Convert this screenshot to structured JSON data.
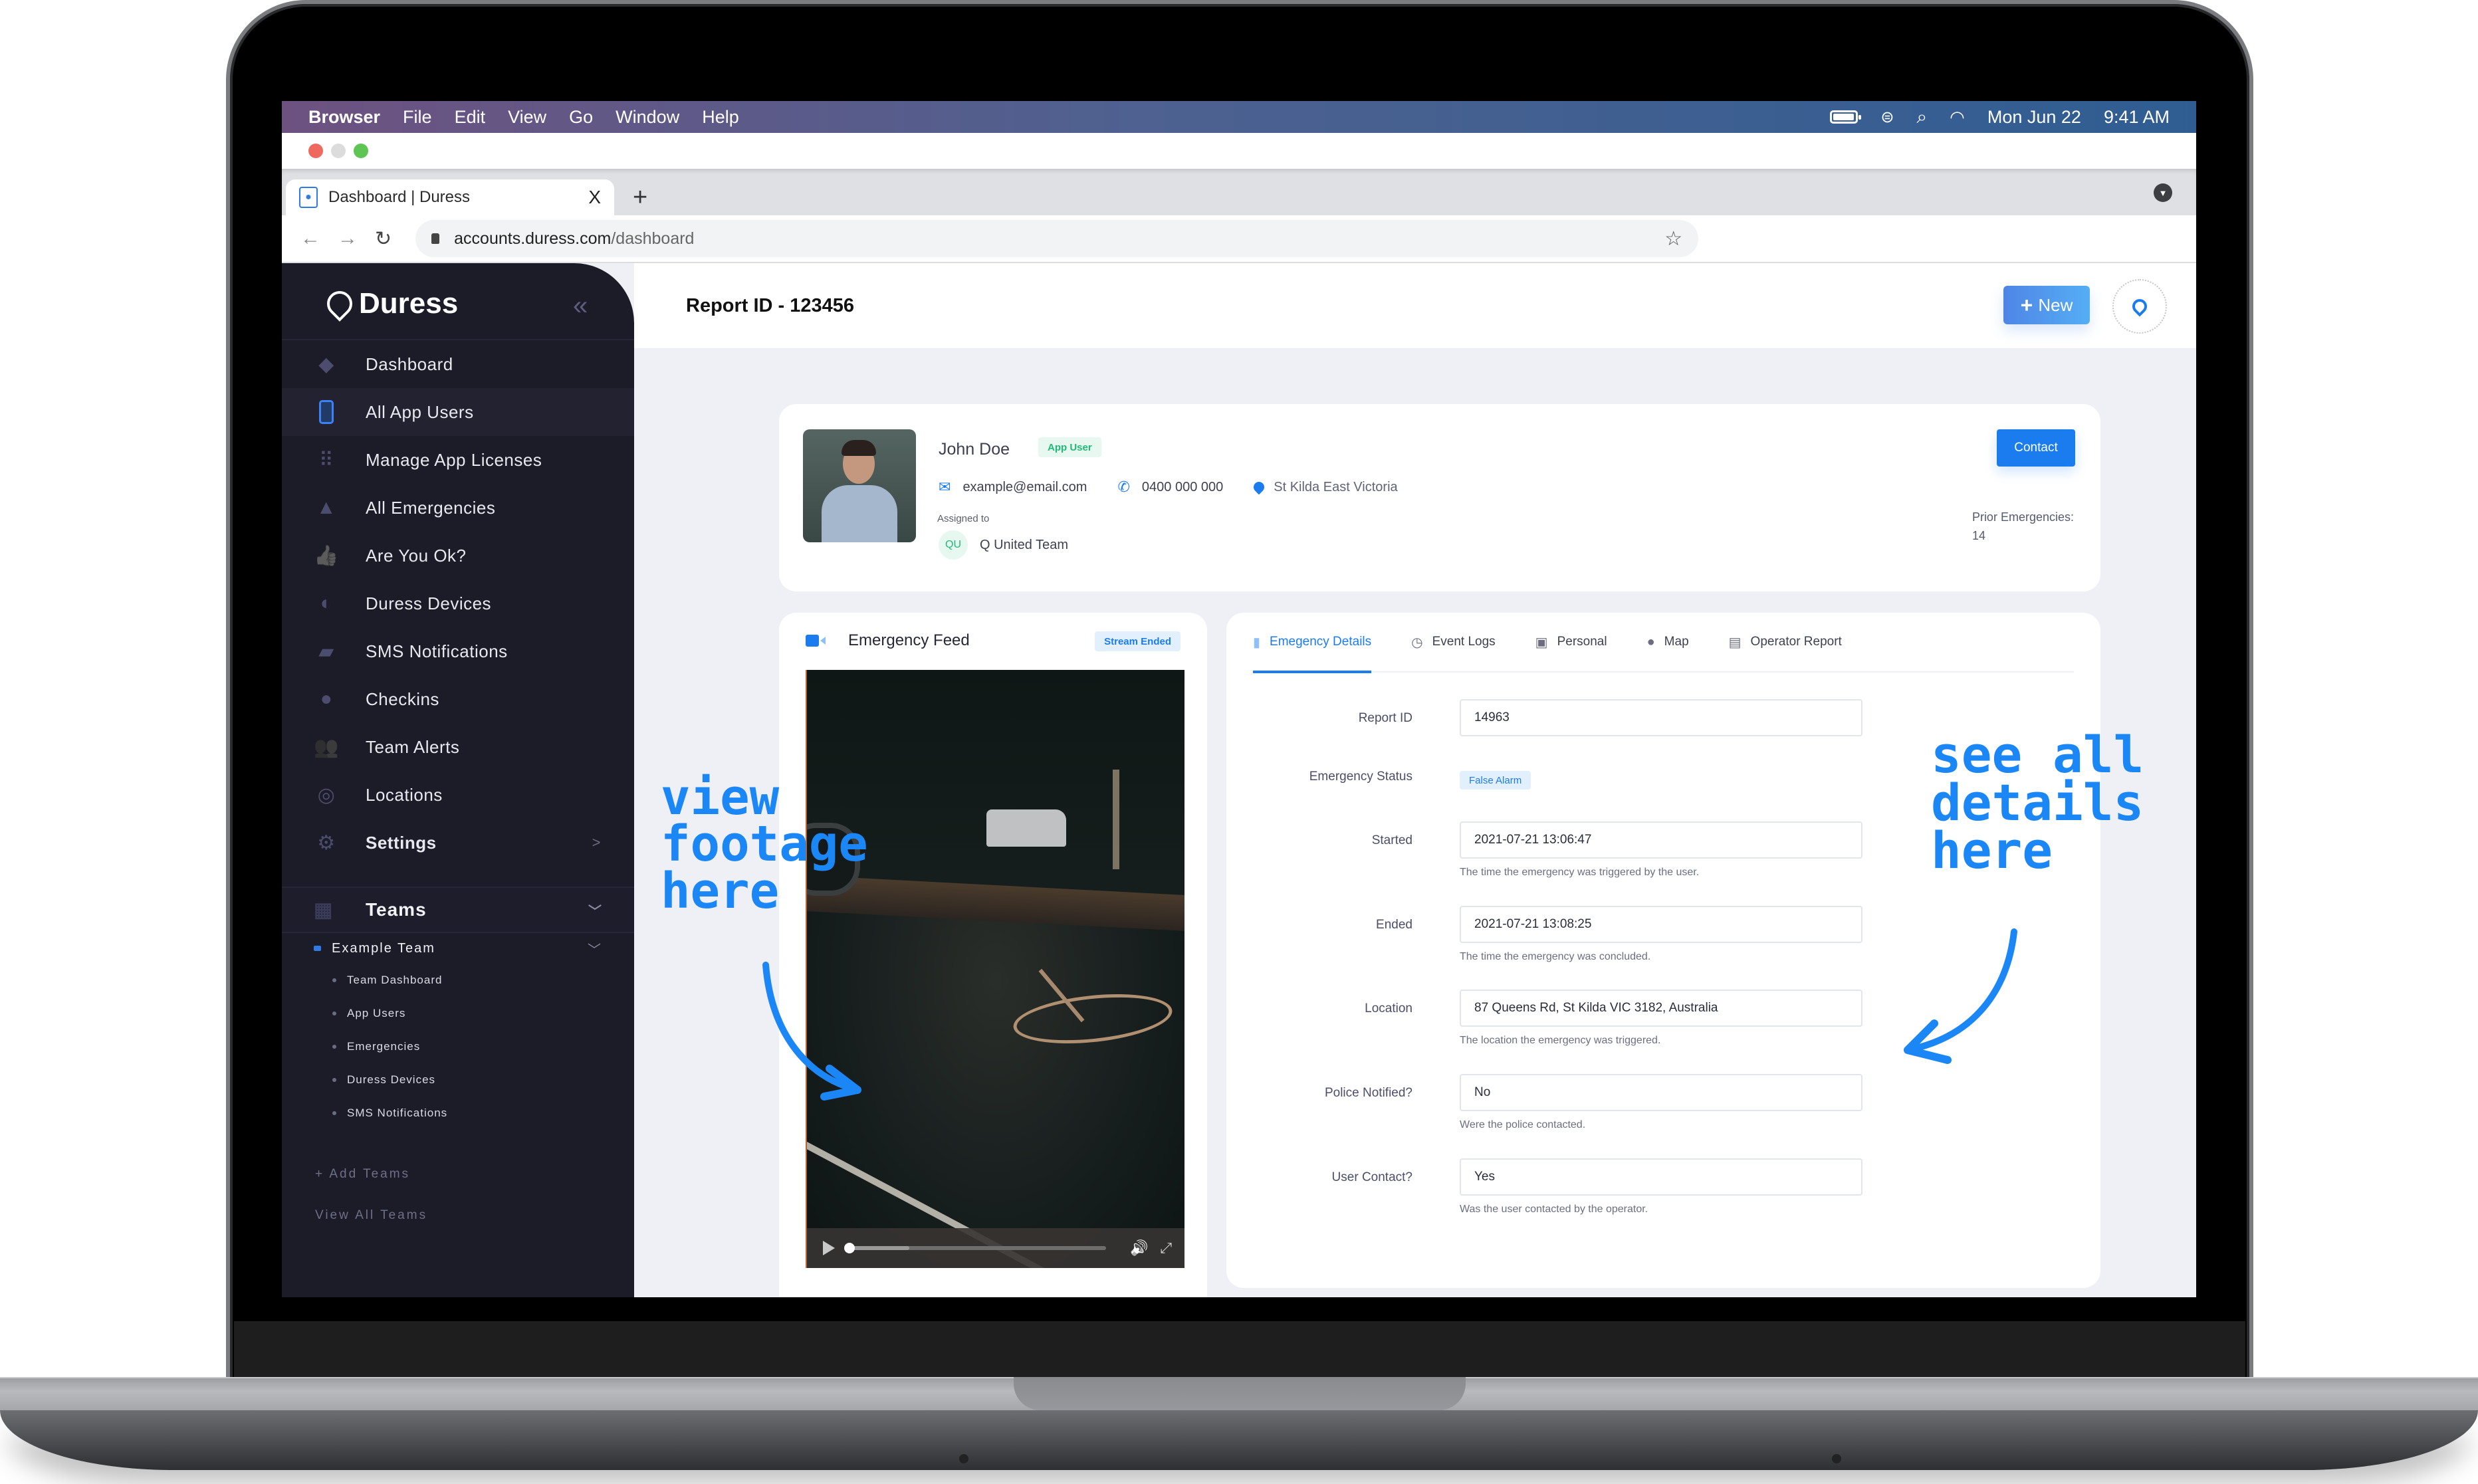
{
  "menubar": {
    "app_name": "Browser",
    "items": [
      "File",
      "Edit",
      "View",
      "Go",
      "Window",
      "Help"
    ],
    "date": "Mon Jun 22",
    "time": "9:41 AM",
    "status_icons": [
      "battery-icon",
      "control-center-icon",
      "search-icon",
      "wifi-icon"
    ]
  },
  "browser": {
    "tab_title": "Dashboard | Duress",
    "tab_close": "X",
    "new_tab": "+",
    "url_host": "accounts.duress.com",
    "url_path": "/dashboard",
    "back": "←",
    "forward": "→",
    "reload": "↻",
    "star": "☆",
    "tab_menu": "▼"
  },
  "sidebar": {
    "brand": "Duress",
    "collapse_icon": "«",
    "items": [
      {
        "label": "Dashboard",
        "icon": "layers-icon",
        "glyph": "◆",
        "active": false
      },
      {
        "label": "All App Users",
        "icon": "phone-icon",
        "glyph": "▯",
        "active": true
      },
      {
        "label": "Manage App Licenses",
        "icon": "licenses-icon",
        "glyph": "⠿",
        "active": false
      },
      {
        "label": "All Emergencies",
        "icon": "warning-icon",
        "glyph": "▲",
        "active": false
      },
      {
        "label": "Are You Ok?",
        "icon": "thumbs-up-icon",
        "glyph": "👍",
        "active": false
      },
      {
        "label": "Duress Devices",
        "icon": "device-icon",
        "glyph": "◐",
        "active": false
      },
      {
        "label": "SMS Notifications",
        "icon": "chat-icon",
        "glyph": "▰",
        "active": false
      },
      {
        "label": "Checkins",
        "icon": "map-pin-icon",
        "glyph": "●",
        "active": false
      },
      {
        "label": "Team Alerts",
        "icon": "users-icon",
        "glyph": "👥",
        "active": false
      },
      {
        "label": "Locations",
        "icon": "target-icon",
        "glyph": "◎",
        "active": false
      },
      {
        "label": "Settings",
        "icon": "gear-icon",
        "glyph": "⚙",
        "active": false,
        "arrow": ">"
      }
    ],
    "teams_label": "Teams",
    "teams_icon_glyph": "▦",
    "chevron": "﹀",
    "team_name": "Example Team",
    "team_links": [
      "Team Dashboard",
      "App Users",
      "Emergencies",
      "Duress Devices",
      "SMS Notifications"
    ],
    "add_teams": "+ Add Teams",
    "view_all_teams": "View All Teams"
  },
  "header": {
    "title": "Report ID - 123456",
    "new_button": "New",
    "new_plus": "+"
  },
  "profile": {
    "name": "John Doe",
    "role_badge": "App User",
    "email": "example@email.com",
    "phone": "0400 000 000",
    "location": "St Kilda East Victoria",
    "assigned_label": "Assigned to",
    "team_initials": "QU",
    "team_name": "Q United Team",
    "contact_button": "Contact",
    "prior_label": "Prior Emergencies:",
    "prior_count": "14",
    "icons": {
      "email": "✉",
      "phone": "✆",
      "location": "📍"
    }
  },
  "feed": {
    "title": "Emergency Feed",
    "status_badge": "Stream Ended",
    "video": {
      "played_fraction": 0.01,
      "buffered_fraction": 0.24,
      "volume_icon": "🔊",
      "fullscreen_icon": "⤢"
    }
  },
  "details": {
    "tabs": [
      {
        "label": "Emegency Details",
        "icon": "clipboard-icon",
        "glyph": "▮",
        "active": true
      },
      {
        "label": "Event Logs",
        "icon": "history-icon",
        "glyph": "◷",
        "active": false
      },
      {
        "label": "Personal",
        "icon": "person-card-icon",
        "glyph": "▣",
        "active": false
      },
      {
        "label": "Map",
        "icon": "map-pin-icon",
        "glyph": "●",
        "active": false
      },
      {
        "label": "Operator Report",
        "icon": "document-icon",
        "glyph": "▤",
        "active": false
      }
    ],
    "fields": {
      "report_id": {
        "label": "Report ID",
        "value": "14963"
      },
      "status": {
        "label": "Emergency Status",
        "value": "False Alarm"
      },
      "started": {
        "label": "Started",
        "value": "2021-07-21 13:06:47",
        "help": "The time the emergency was triggered by the user."
      },
      "ended": {
        "label": "Ended",
        "value": "2021-07-21 13:08:25",
        "help": "The time the emergency was concluded."
      },
      "location": {
        "label": "Location",
        "value": "87 Queens Rd, St Kilda VIC 3182, Australia",
        "help": "The location the emergency was triggered."
      },
      "police": {
        "label": "Police Notified?",
        "value": "No",
        "help": "Were the police contacted."
      },
      "user_contact": {
        "label": "User Contact?",
        "value": "Yes",
        "help": "Was the user contacted by the operator."
      }
    }
  },
  "annotations": {
    "left": [
      "view",
      "footage",
      "here"
    ],
    "right": [
      "see all",
      "details",
      "here"
    ]
  },
  "colors": {
    "accent": "#1b7cf0",
    "sidebar_bg": "#1c1c28",
    "content_bg": "#eef0f5",
    "success": "#21b976",
    "annotation": "#1b86f5"
  }
}
